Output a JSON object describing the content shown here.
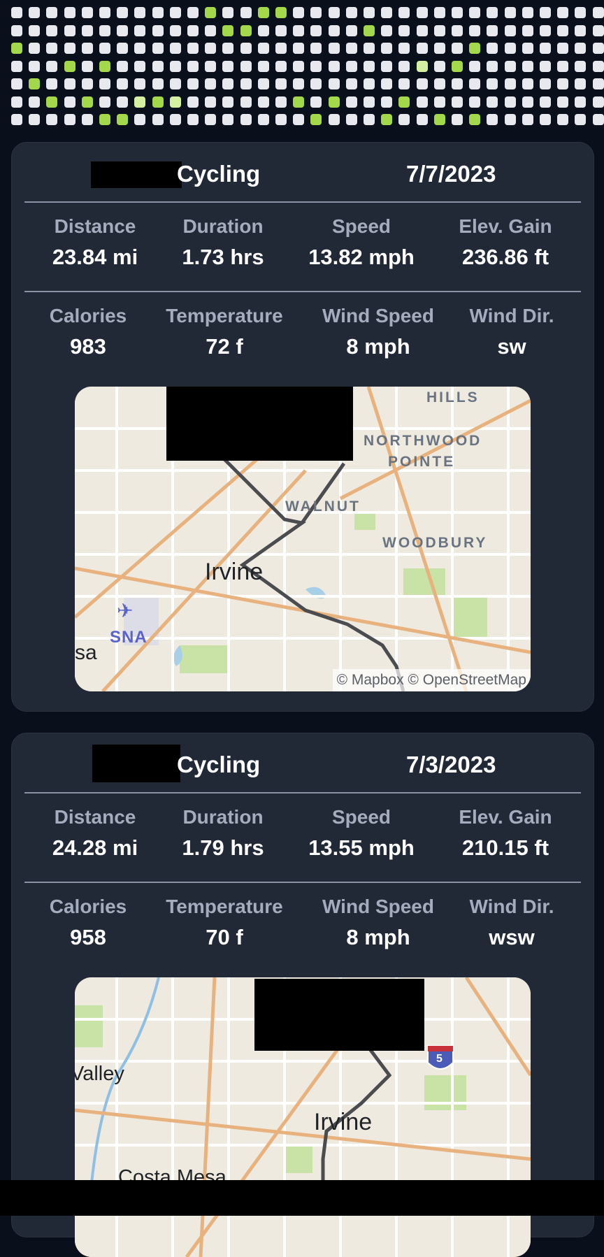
{
  "heatmap": {
    "label": "Activity calendar heatmap",
    "base_color": "#e8e9ee",
    "active_color": "#a3d84a",
    "light_active_color": "#d4f0a0",
    "rows": 7,
    "cols": 34
  },
  "activities": [
    {
      "type": "Cycling",
      "date": "7/7/2023",
      "stats_row1": [
        {
          "label": "Distance",
          "value": "23.84 mi"
        },
        {
          "label": "Duration",
          "value": "1.73 hrs"
        },
        {
          "label": "Speed",
          "value": "13.82 mph"
        },
        {
          "label": "Elev. Gain",
          "value": "236.86 ft"
        }
      ],
      "stats_row2": [
        {
          "label": "Calories",
          "value": "983"
        },
        {
          "label": "Temperature",
          "value": "72 f"
        },
        {
          "label": "Wind Speed",
          "value": "8 mph"
        },
        {
          "label": "Wind Dir.",
          "value": "sw"
        }
      ],
      "map": {
        "labels": [
          "HILLS",
          "NORTHWOOD",
          "POINTE",
          "WALNUT",
          "WOODBURY"
        ],
        "city": "Irvine",
        "airport": "SNA",
        "partial": "sa",
        "attribution": "© Mapbox © OpenStreetMap"
      }
    },
    {
      "type": "Cycling",
      "date": "7/3/2023",
      "stats_row1": [
        {
          "label": "Distance",
          "value": "24.28 mi"
        },
        {
          "label": "Duration",
          "value": "1.79 hrs"
        },
        {
          "label": "Speed",
          "value": "13.55 mph"
        },
        {
          "label": "Elev. Gain",
          "value": "210.15 ft"
        }
      ],
      "stats_row2": [
        {
          "label": "Calories",
          "value": "958"
        },
        {
          "label": "Temperature",
          "value": "70 f"
        },
        {
          "label": "Wind Speed",
          "value": "8 mph"
        },
        {
          "label": "Wind Dir.",
          "value": "wsw"
        }
      ],
      "map": {
        "city": "Irvine",
        "partial_left": "Valley",
        "partial_bottom": "Costa Mesa",
        "highway_shield": "5"
      }
    }
  ]
}
